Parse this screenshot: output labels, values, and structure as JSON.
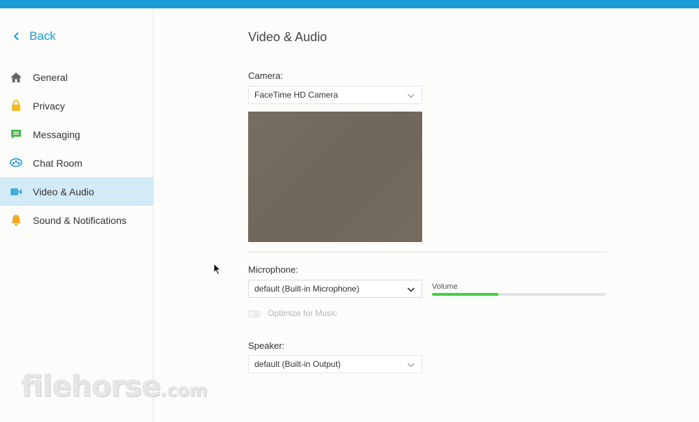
{
  "colors": {
    "accent": "#1c9ad6",
    "active_nav_bg": "#d3eaf7",
    "volume_fill": "#3fd23a"
  },
  "sidebar": {
    "back_label": "Back",
    "items": [
      {
        "label": "General",
        "icon": "home-icon",
        "icon_color": "#666666"
      },
      {
        "label": "Privacy",
        "icon": "lock-icon",
        "icon_color": "#f5b921"
      },
      {
        "label": "Messaging",
        "icon": "message-icon",
        "icon_color": "#47b54b"
      },
      {
        "label": "Chat Room",
        "icon": "chat-room-icon",
        "icon_color": "#1c9ad6"
      },
      {
        "label": "Video & Audio",
        "icon": "video-camera-icon",
        "icon_color": "#3fb1d8",
        "active": true
      },
      {
        "label": "Sound & Notifications",
        "icon": "bell-icon",
        "icon_color": "#f5a623"
      }
    ]
  },
  "main": {
    "title": "Video & Audio",
    "camera": {
      "label": "Camera:",
      "selected": "FaceTime HD Camera"
    },
    "microphone": {
      "label": "Microphone:",
      "selected": "default (Built-in Microphone)",
      "volume_label": "Volume",
      "volume_level": 0.38,
      "optimize_label": "Optimize for Music",
      "optimize_enabled": false
    },
    "speaker": {
      "label": "Speaker:",
      "selected": "default (Built-in Output)"
    }
  },
  "watermark": {
    "text": "filehorse",
    "suffix": ".com"
  }
}
